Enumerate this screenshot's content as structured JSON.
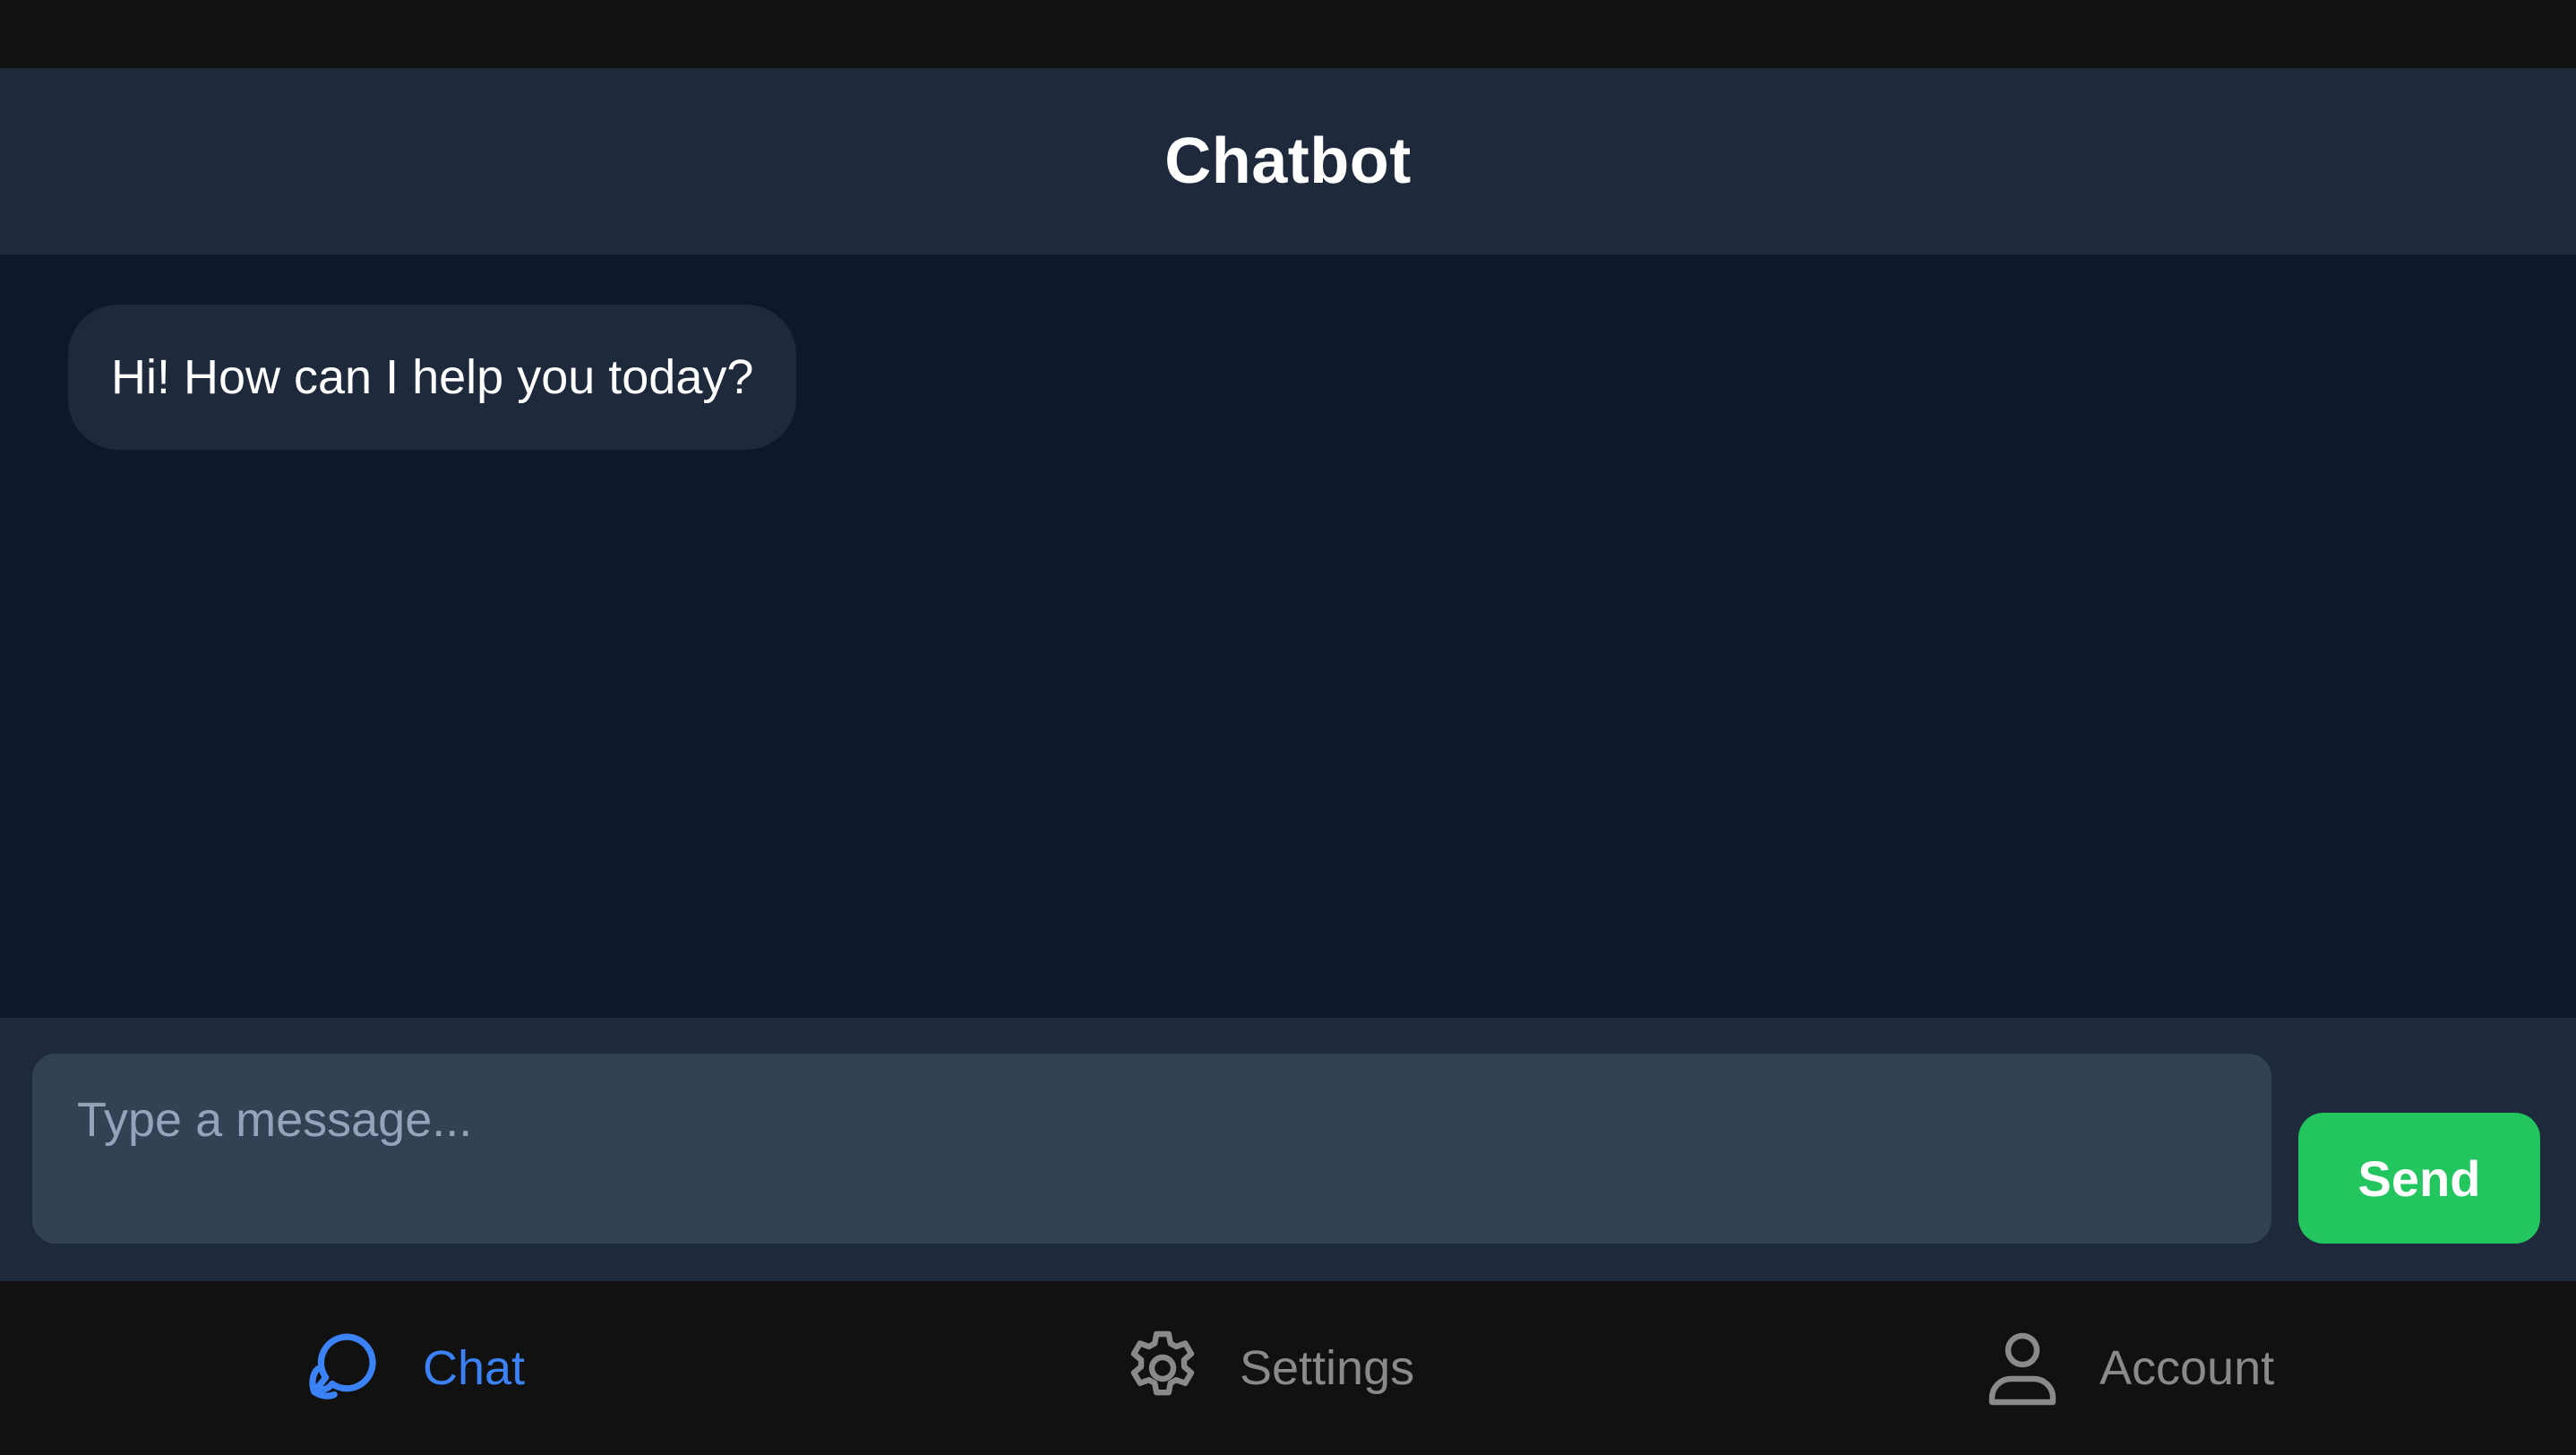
{
  "header": {
    "title": "Chatbot"
  },
  "messages": [
    {
      "sender": "bot",
      "text": "Hi! How can I help you today?"
    }
  ],
  "composer": {
    "placeholder": "Type a message...",
    "value": "",
    "send_label": "Send"
  },
  "nav": {
    "items": [
      {
        "label": "Chat",
        "icon": "chat-bubbles-icon",
        "active": true
      },
      {
        "label": "Settings",
        "icon": "gear-icon",
        "active": false
      },
      {
        "label": "Account",
        "icon": "user-icon",
        "active": false
      }
    ]
  },
  "colors": {
    "header_bg": "#1e293b",
    "chat_bg": "#0f172a",
    "bubble_bg": "#1e293b",
    "input_bg": "#334155",
    "send_green": "#22c55e",
    "active_blue": "#3b82f6",
    "inactive_gray": "#8a8a8a",
    "nav_bg": "#111111"
  }
}
